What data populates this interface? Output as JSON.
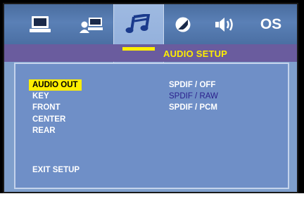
{
  "tabs": [
    {
      "icon": "monitor-icon"
    },
    {
      "icon": "person-keyboard-icon"
    },
    {
      "icon": "music-note-icon",
      "active": true
    },
    {
      "icon": "video-circle-icon"
    },
    {
      "icon": "speaker-icon"
    },
    {
      "label": "OS"
    }
  ],
  "page_title": "AUDIO SETUP",
  "menu_items": [
    {
      "label": "AUDIO OUT",
      "selected": true
    },
    {
      "label": "KEY"
    },
    {
      "label": "FRONT"
    },
    {
      "label": "CENTER"
    },
    {
      "label": "REAR"
    },
    {
      "label": "EXIT SETUP"
    }
  ],
  "options": [
    {
      "label": "SPDIF / OFF"
    },
    {
      "label": "SPDIF / RAW",
      "current": true
    },
    {
      "label": "SPDIF / PCM"
    }
  ],
  "colors": {
    "accent": "#ffee00",
    "title_bar": "#6a5c9e",
    "panel": "#6f8fc7",
    "current_option": "#2a1f8c"
  }
}
